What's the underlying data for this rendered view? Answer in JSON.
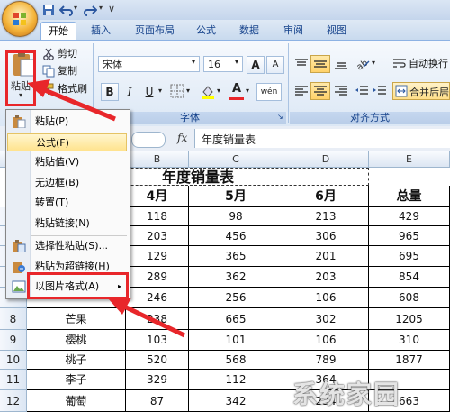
{
  "quick_access": {
    "undo_icon": "undo-icon",
    "redo_icon": "redo-icon",
    "save_icon": "save-icon"
  },
  "tabs": [
    "开始",
    "插入",
    "页面布局",
    "公式",
    "数据",
    "审阅",
    "视图"
  ],
  "ribbon": {
    "clipboard": {
      "paste_label": "粘贴",
      "cut_label": "剪切",
      "copy_label": "复制",
      "format_painter_label": "格式刷"
    },
    "font": {
      "font_name": "宋体",
      "font_size": "16",
      "group_label": "字体",
      "grow_glyph": "A",
      "shrink_glyph": "A",
      "bold": "B",
      "italic": "I",
      "underline": "U",
      "font_color_glyph": "A",
      "phonetic": "wén"
    },
    "alignment": {
      "group_label": "对齐方式",
      "wrap_text_label": "自动换行",
      "merge_label": "合并后居"
    }
  },
  "formula_bar": {
    "fx_label": "fx",
    "content": "年度销量表"
  },
  "sheet": {
    "columns": [
      "B",
      "C",
      "D",
      "E"
    ],
    "title": "年度销量表",
    "header_row": [
      "4月",
      "5月",
      "6月",
      "总量"
    ],
    "row_numbers": [
      "8",
      "9",
      "10",
      "11",
      "12"
    ],
    "rows": [
      {
        "name": "",
        "values": [
          "118",
          "98",
          "213",
          "429"
        ]
      },
      {
        "name": "",
        "values": [
          "203",
          "456",
          "306",
          "965"
        ]
      },
      {
        "name": "",
        "values": [
          "129",
          "365",
          "201",
          "695"
        ]
      },
      {
        "name": "",
        "values": [
          "289",
          "362",
          "203",
          "854"
        ]
      },
      {
        "name": "",
        "values": [
          "246",
          "256",
          "106",
          "608"
        ]
      },
      {
        "name": "芒果",
        "values": [
          "238",
          "665",
          "302",
          "1205"
        ]
      },
      {
        "name": "樱桃",
        "values": [
          "103",
          "101",
          "106",
          "310"
        ]
      },
      {
        "name": "桃子",
        "values": [
          "520",
          "568",
          "789",
          "1877"
        ]
      },
      {
        "name": "李子",
        "values": [
          "329",
          "112",
          "364",
          ""
        ]
      },
      {
        "name": "葡萄",
        "values": [
          "87",
          "342",
          "234",
          "663"
        ]
      }
    ]
  },
  "paste_menu": {
    "items": [
      {
        "label": "粘贴(P)",
        "icon": "paste-icon"
      },
      {
        "label": "公式(F)",
        "icon": ""
      },
      {
        "label": "粘贴值(V)",
        "icon": ""
      },
      {
        "label": "无边框(B)",
        "icon": ""
      },
      {
        "label": "转置(T)",
        "icon": ""
      },
      {
        "label": "粘贴链接(N)",
        "icon": ""
      },
      {
        "label": "选择性粘贴(S)...",
        "icon": "paste-special-icon"
      },
      {
        "label": "粘贴为超链接(H)",
        "icon": "hyperlink-icon"
      },
      {
        "label": "以图片格式(A)",
        "icon": "picture-icon"
      }
    ],
    "highlighted_index": 1
  },
  "colors": {
    "highlight_red": "#e8262a",
    "ribbon_blue": "#15428b"
  },
  "watermark": "系统家园"
}
